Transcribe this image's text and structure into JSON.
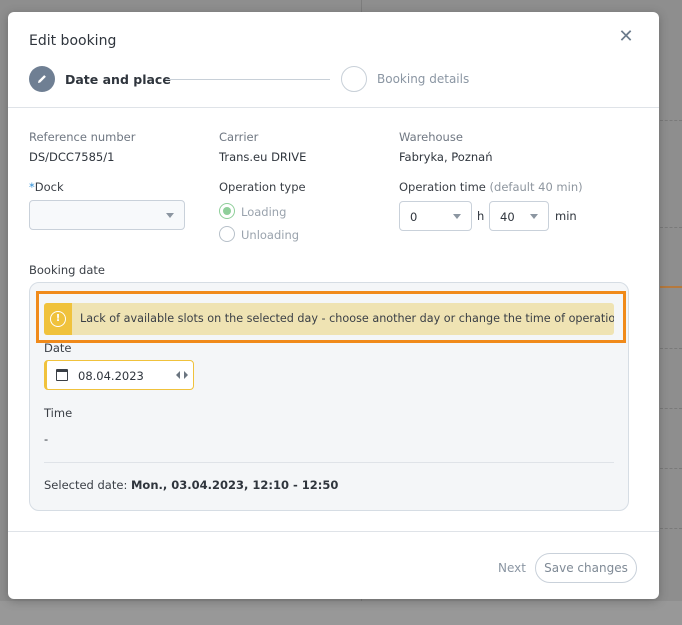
{
  "modal": {
    "title": "Edit booking",
    "close_icon": "close-icon"
  },
  "steps": [
    {
      "label": "Date and place",
      "active": true,
      "icon": "pencil-icon"
    },
    {
      "label": "Booking details",
      "active": false
    }
  ],
  "info": {
    "reference_label": "Reference number",
    "reference_value": "DS/DCC7585/1",
    "carrier_label": "Carrier",
    "carrier_value": "Trans.eu DRIVE",
    "warehouse_label": "Warehouse",
    "warehouse_value": "Fabryka, Poznań"
  },
  "dock": {
    "required_mark": "*",
    "label": "Dock",
    "value": ""
  },
  "operation_type": {
    "label": "Operation type",
    "options": [
      {
        "label": "Loading",
        "checked": true
      },
      {
        "label": "Unloading",
        "checked": false
      }
    ]
  },
  "operation_time": {
    "label": "Operation time",
    "hint": "(default 40 min)",
    "hours": "0",
    "hours_unit": "h",
    "minutes": "40",
    "minutes_unit": "min"
  },
  "booking_date": {
    "label": "Booking date",
    "alert": "Lack of available slots on the selected day - choose another day or change the time of operation.",
    "alert_icon": "exclamation-icon",
    "date_label": "Date",
    "date_value": "08.04.2023",
    "time_label": "Time",
    "time_value": "-",
    "selected_prefix": "Selected date:",
    "selected_value": "Mon., 03.04.2023, 12:10 - 12:50"
  },
  "footer": {
    "next_label": "Next",
    "save_label": "Save changes"
  },
  "colors": {
    "accent": "#f08a1a",
    "alert_bg": "#efe3b3",
    "alert_icon_bg": "#f0c23c",
    "step_active": "#6f7f93",
    "radio_checked": "#8fcf9a",
    "required": "#2f8fd6"
  }
}
